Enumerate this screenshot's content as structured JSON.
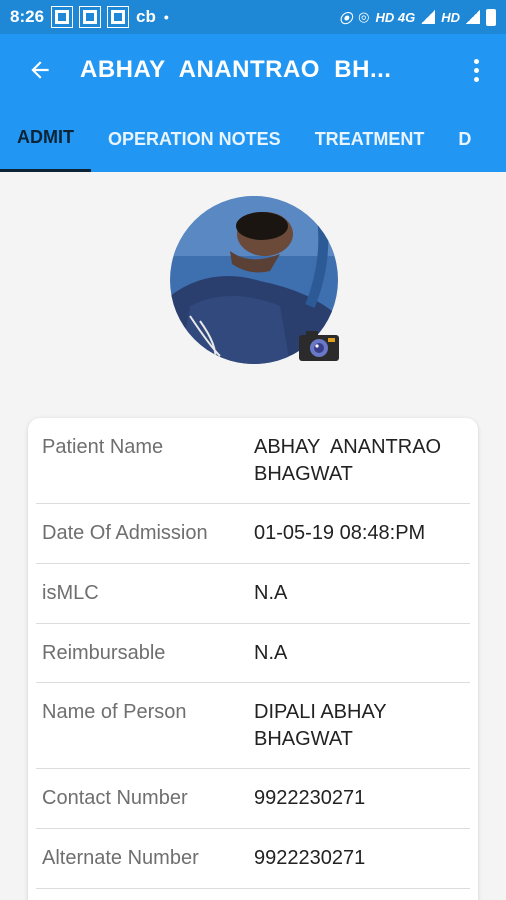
{
  "status_bar": {
    "time": "8:26",
    "carrier_text": "cb",
    "net1": "HD 4G",
    "net2": "HD"
  },
  "app_bar": {
    "title": "ABHAY  ANANTRAO  BH..."
  },
  "tabs": [
    {
      "label": "ADMIT"
    },
    {
      "label": "OPERATION NOTES"
    },
    {
      "label": "TREATMENT"
    },
    {
      "label": "D"
    }
  ],
  "details": [
    {
      "label": "Patient Name",
      "value": "ABHAY  ANANTRAO\nBHAGWAT"
    },
    {
      "label": "Date Of Admission",
      "value": "01-05-19 08:48:PM"
    },
    {
      "label": "isMLC",
      "value": "N.A"
    },
    {
      "label": "Reimbursable",
      "value": "N.A"
    },
    {
      "label": "Name of Person",
      "value": "DIPALI ABHAY\nBHAGWAT"
    },
    {
      "label": "Contact Number",
      "value": "9922230271"
    },
    {
      "label": "Alternate Number",
      "value": "9922230271"
    }
  ],
  "colors": {
    "primary": "#2196f3",
    "status_bar": "#1e88d6",
    "active_tab": "#0d2436"
  }
}
